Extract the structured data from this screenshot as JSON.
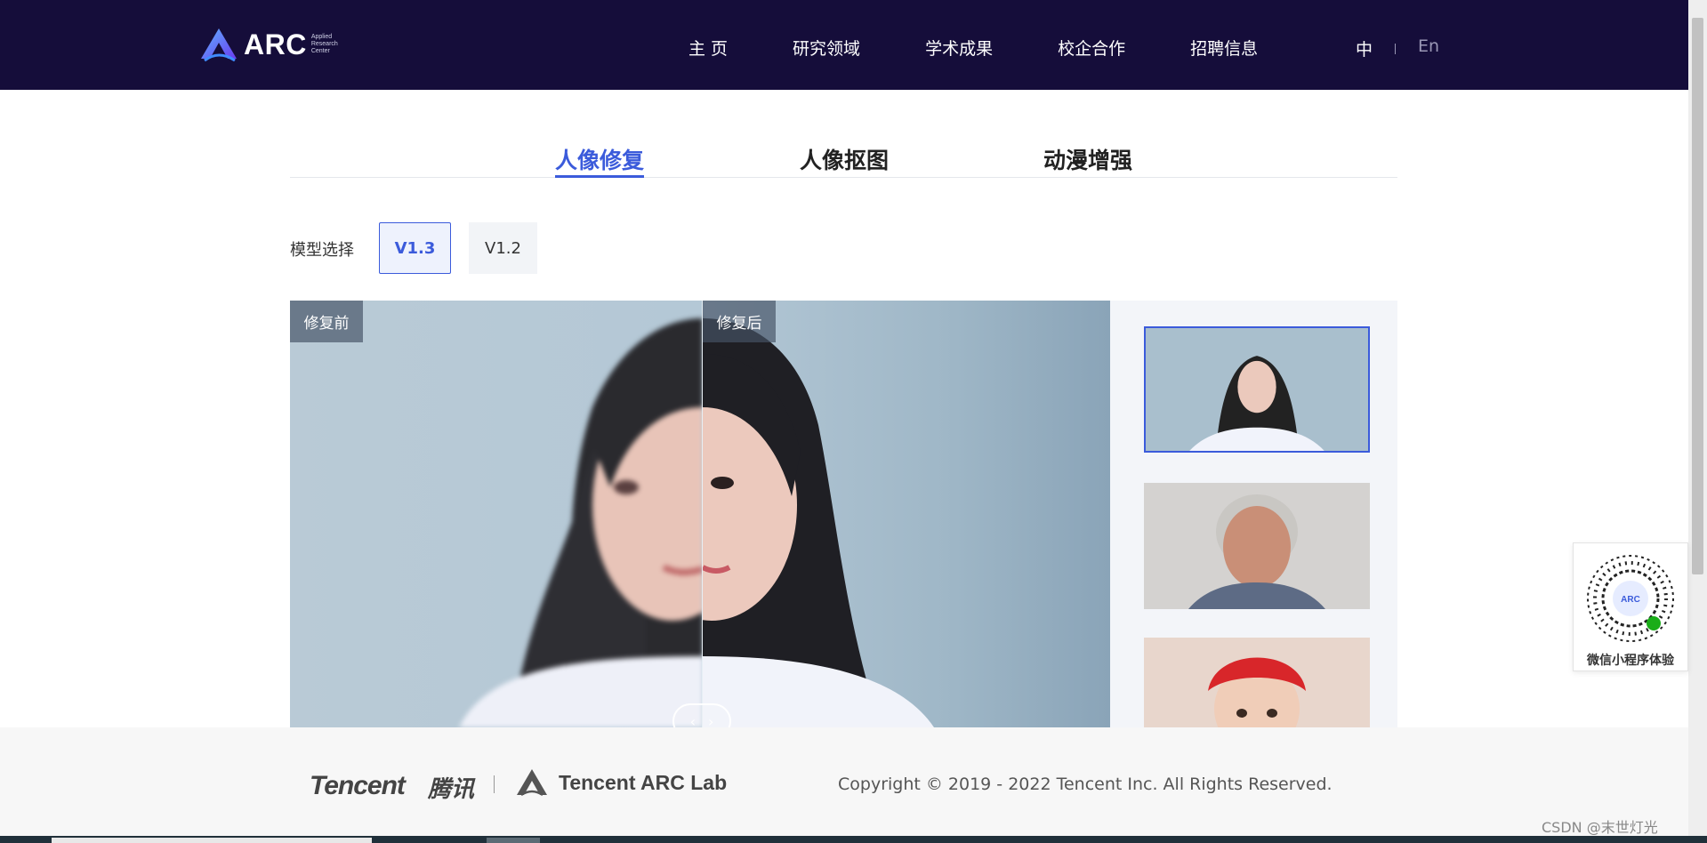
{
  "header": {
    "logo_text": "ARC",
    "logo_subtitle": [
      "Applied",
      "Research",
      "Center"
    ],
    "nav": [
      "主 页",
      "研究领域",
      "学术成果",
      "校企合作",
      "招聘信息"
    ],
    "lang_zh": "中",
    "lang_en": "En"
  },
  "tabs": [
    {
      "label": "人像修复",
      "active": true
    },
    {
      "label": "人像抠图",
      "active": false
    },
    {
      "label": "动漫增强",
      "active": false
    }
  ],
  "model": {
    "label": "模型选择",
    "versions": [
      {
        "label": "V1.3",
        "active": true
      },
      {
        "label": "V1.2",
        "active": false
      }
    ]
  },
  "compare": {
    "before_label": "修复前",
    "after_label": "修复后",
    "slider_position_pct": 50
  },
  "thumbnails": {
    "selected_index": 0,
    "items": [
      "woman-portrait",
      "elderly-man-portrait",
      "baby-portrait"
    ]
  },
  "footer": {
    "tencent": "Tencent",
    "tencent_cn": "腾讯",
    "arc_lab": "Tencent  ARC Lab",
    "copyright": "Copyright © 2019 - 2022 Tencent Inc. All Rights Reserved."
  },
  "qr": {
    "caption": "微信小程序体验",
    "center_text": "ARC"
  },
  "watermark": "CSDN @末世灯光",
  "colors": {
    "nav_bg": "#150d3a",
    "accent": "#3b5bdb",
    "footer_bg": "#f7f7f7"
  }
}
